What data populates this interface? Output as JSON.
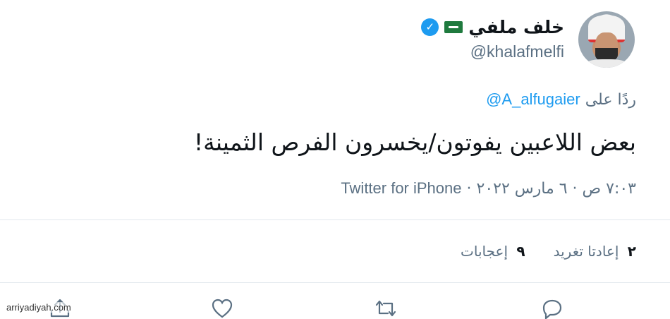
{
  "tweet": {
    "author": {
      "name": "خلف ملفي",
      "handle": "@khalafmelfi",
      "verified": true,
      "flag": "saudi-flag"
    },
    "reply_prefix": "ردًا على",
    "reply_mention": "@A_alfugaier",
    "text": "بعض اللاعبين يفوتون/يخسرون الفرص الثمينة!",
    "timestamp": "٧:٠٣ ص · ٦ مارس ٢٠٢٢",
    "separator": "·",
    "client": "Twitter for iPhone"
  },
  "stats": {
    "retweets_count": "٢",
    "retweets_label": "إعادتا تغريد",
    "likes_count": "٩",
    "likes_label": "إعجابات"
  },
  "actions": [
    "reply-icon",
    "retweet-icon",
    "like-icon",
    "share-icon"
  ],
  "colors": {
    "accent": "#1d9bf0",
    "secondary_text": "#5b7083",
    "primary_text": "#0f1419",
    "divider": "#e1e8ed"
  },
  "watermark": "arriyadiyah.com"
}
